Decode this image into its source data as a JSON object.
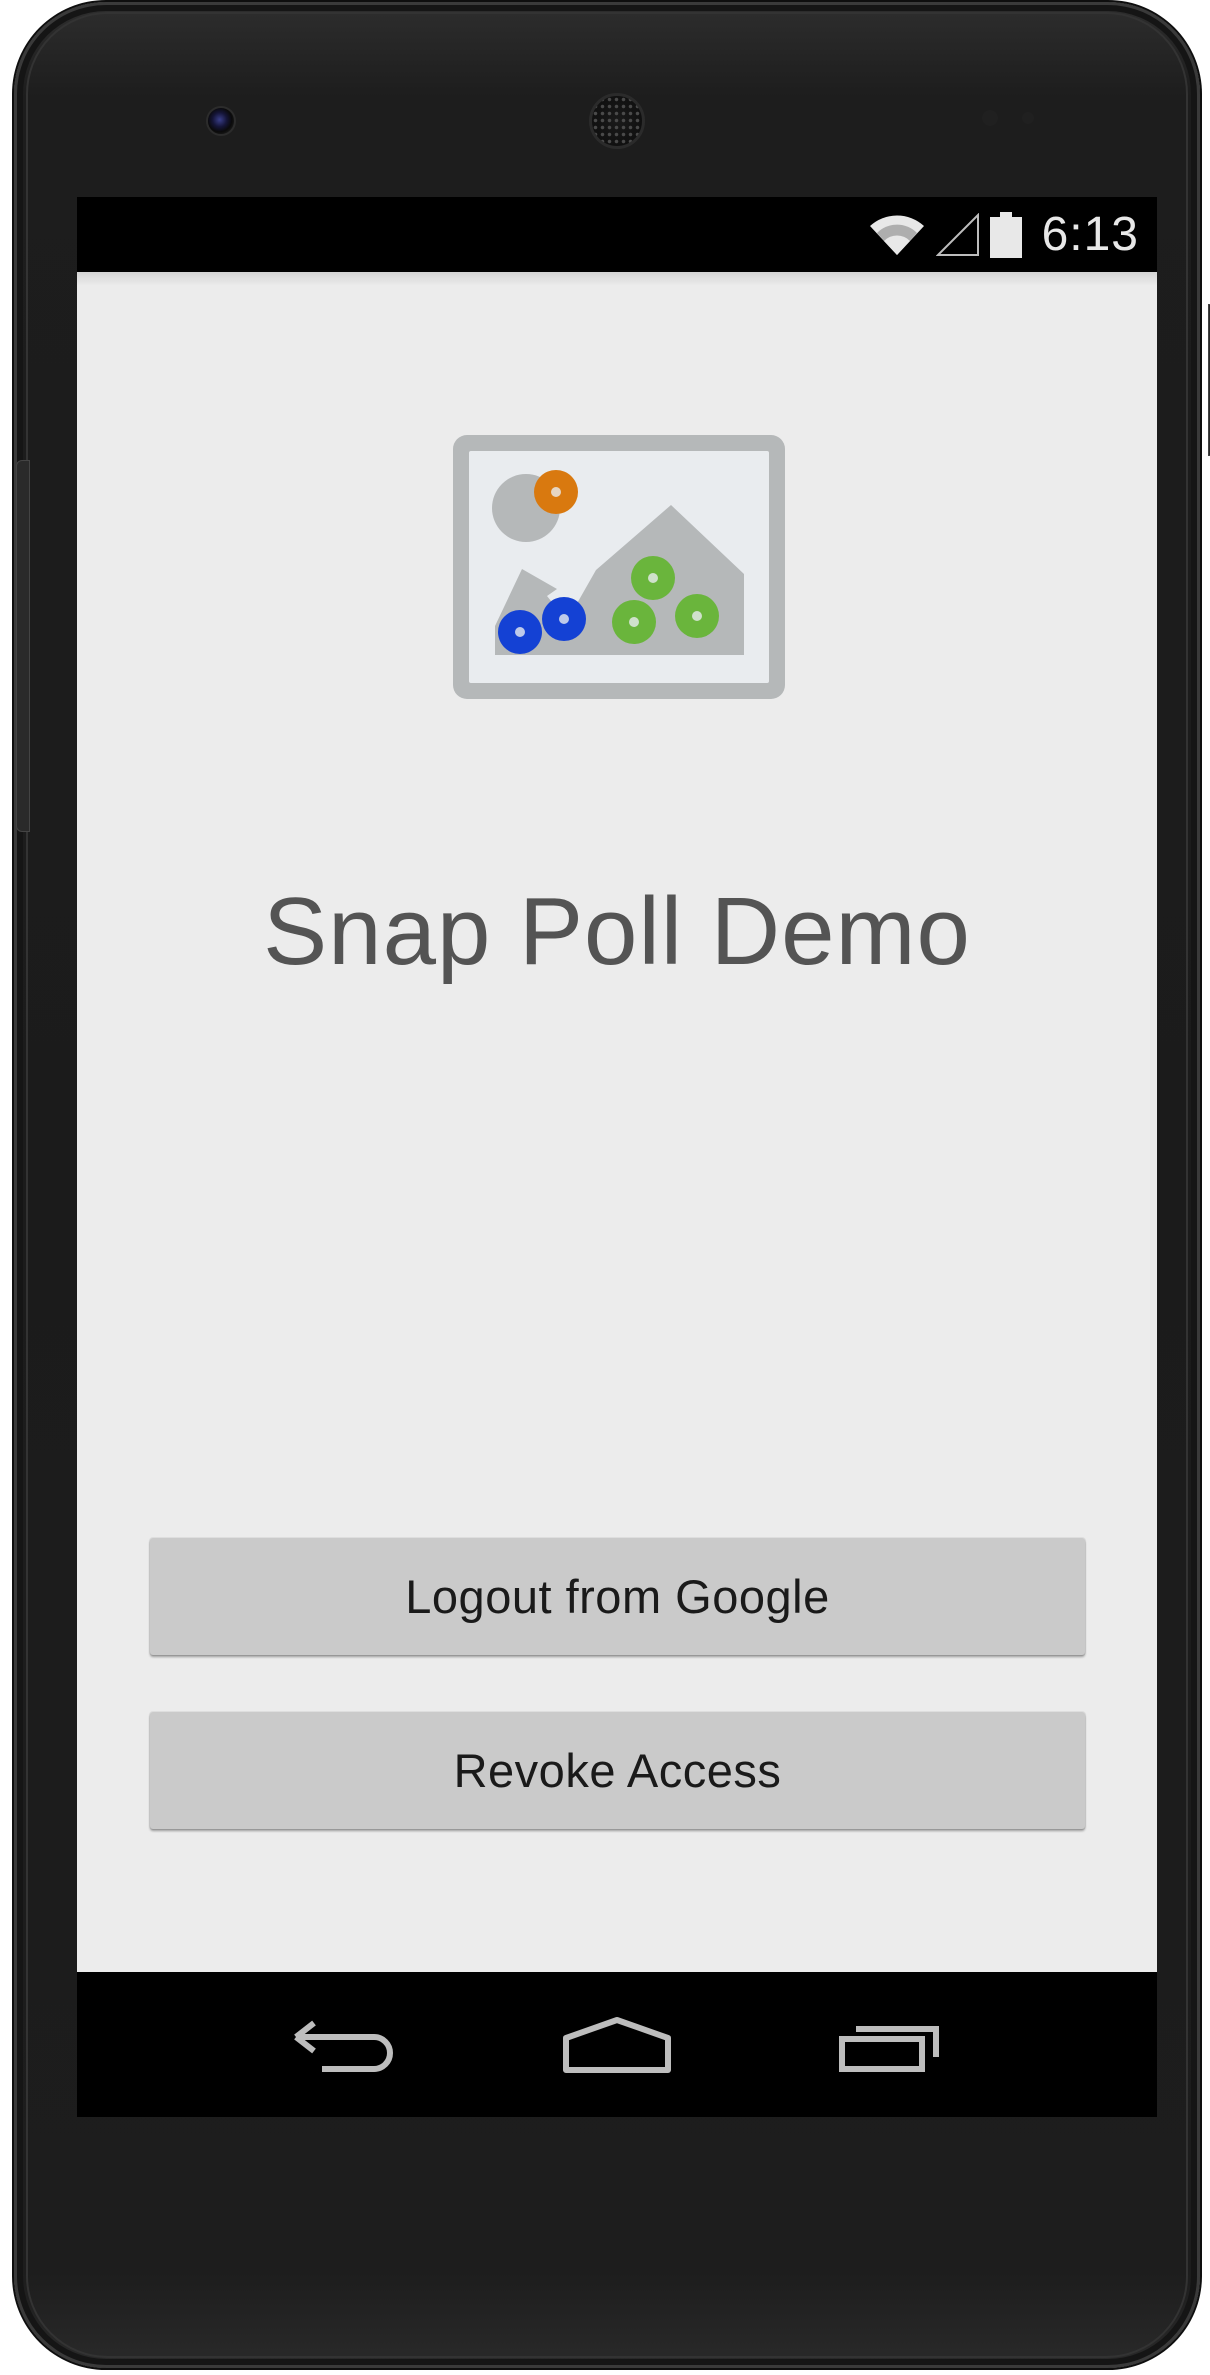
{
  "status_bar": {
    "time": "6:13",
    "icons": [
      "wifi-icon",
      "cell-signal-icon",
      "battery-icon"
    ]
  },
  "app": {
    "title": "Snap Poll Demo",
    "logo_icon": "image-poll-logo-icon",
    "buttons": {
      "logout": "Logout from Google",
      "revoke": "Revoke Access"
    }
  },
  "nav_bar": {
    "icons": [
      "back-icon",
      "home-icon",
      "recents-icon"
    ]
  },
  "colors": {
    "background": "#ececec",
    "button": "#cacaca",
    "title_text": "#545454",
    "logo_orange": "#d9790f",
    "logo_blue": "#1441d4",
    "logo_green": "#6ab53c",
    "logo_frame": "#b5b8b9"
  }
}
